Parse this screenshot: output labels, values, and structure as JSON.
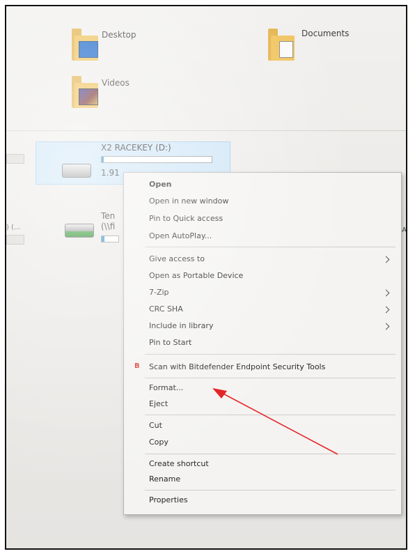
{
  "folders": [
    {
      "label": "Desktop",
      "icon": "desktop-folder-icon"
    },
    {
      "label": "Documents",
      "icon": "documents-folder-icon"
    },
    {
      "label": "Videos",
      "icon": "videos-folder-icon"
    }
  ],
  "drives": {
    "selected": {
      "label": "X2 RACEKEY (D:)",
      "free_partial": "1.91",
      "fill_fraction": 0.02
    },
    "second": {
      "label_partial": "Ten",
      "path_partial": "(\\\\fi",
      "fill_fraction": 0.15
    }
  },
  "side_labels": {
    "left": ") (...",
    "right": "aA..."
  },
  "context_menu": {
    "open": "Open",
    "open_new_window": "Open in new window",
    "pin_quick_access": "Pin to Quick access",
    "open_autoplay": "Open AutoPlay...",
    "give_access": "Give access to",
    "open_portable": "Open as Portable Device",
    "seven_zip": "7-Zip",
    "crc_sha": "CRC SHA",
    "include_library": "Include in library",
    "pin_start": "Pin to Start",
    "bitdefender_glyph": "B",
    "scan_bitdefender": "Scan with Bitdefender Endpoint Security Tools",
    "format": "Format...",
    "eject": "Eject",
    "cut": "Cut",
    "copy": "Copy",
    "create_shortcut": "Create shortcut",
    "rename": "Rename",
    "properties": "Properties"
  },
  "colors": {
    "selection": "#cfe6f7",
    "capacity_bar": "#2f95d8",
    "annotation_arrow": "#e32626",
    "bitdefender": "#d8332a"
  }
}
